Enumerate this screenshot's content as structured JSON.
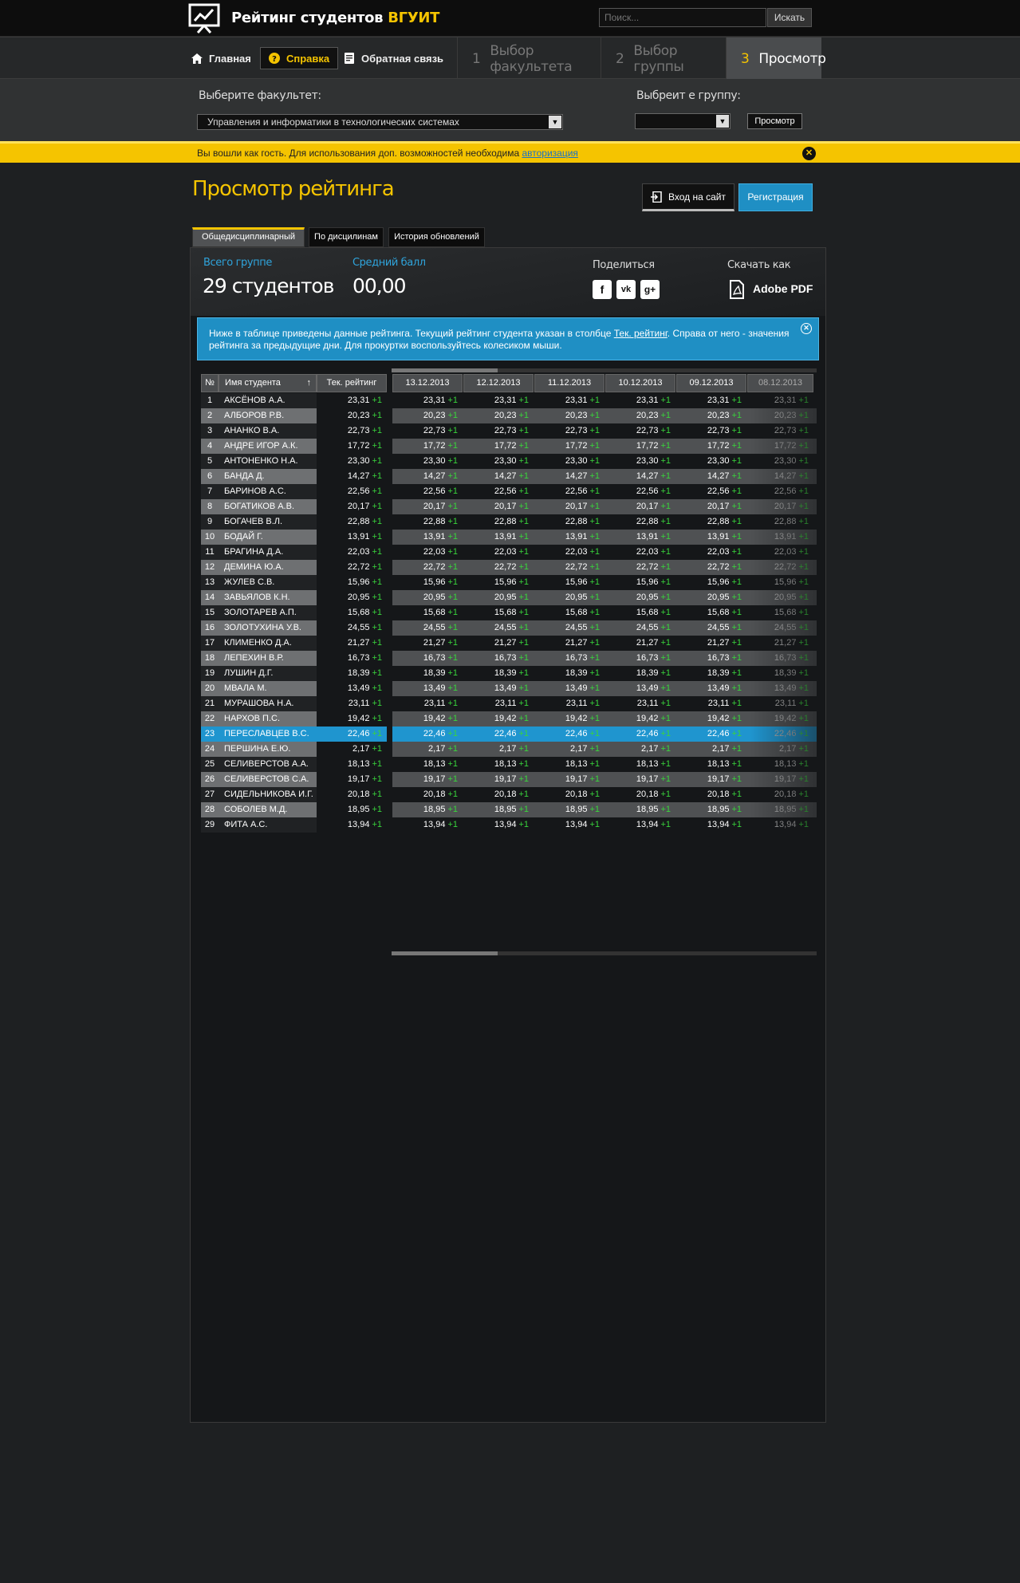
{
  "app": {
    "title_main": "Рейтинг студентов ",
    "title_accent": "ВГУИТ"
  },
  "search": {
    "placeholder": "Поиск...",
    "button": "Искать"
  },
  "nav": {
    "home": "Главная",
    "help": "Справка",
    "feedback": "Обратная связь",
    "steps": [
      {
        "num": "1",
        "label": "Выбор факультета"
      },
      {
        "num": "2",
        "label": "Выбор группы"
      },
      {
        "num": "3",
        "label": "Просмотр"
      }
    ]
  },
  "selector": {
    "faculty_label": "Выберите факультет:",
    "faculty_value": "Управления и информатики в технологических системах",
    "group_label": "Выбреит е группу:",
    "group_value": "",
    "view_button": "Просмотр"
  },
  "banner": {
    "text": "Вы вошли как гость. Для использования доп. возможностей необходима ",
    "link": "авторизация"
  },
  "page": {
    "title": "Просмотр рейтинга",
    "login_button": "Вход на сайт",
    "register_button": "Регистрация"
  },
  "tabs": [
    "Общедисциплинарный",
    "По дисцилинам",
    "История обновлений"
  ],
  "stats": {
    "total_label": "Всего группе",
    "total_value": "29 студентов",
    "avg_label": "Средний балл",
    "avg_value": "00,00",
    "share_label": "Поделиться",
    "download_label": "Скачать как",
    "download_format": "Adobe PDF"
  },
  "info": {
    "text_before": "Ниже в таблице приведены данные рейтинга. Текущий рейтинг студента указан в столбце ",
    "link": "Тек. рейтинг",
    "text_after": ". Справа от него - значения рейтинга за предыдущие дни. Для прокуртки воспользуйтесь колесиком мыши."
  },
  "table": {
    "headers": {
      "num": "№",
      "name": "Имя студента",
      "sort_icon": "↑",
      "current": "Тек. рейтинг"
    },
    "dates": [
      "13.12.2013",
      "12.12.2013",
      "11.12.2013",
      "10.12.2013",
      "09.12.2013",
      "08.12.2013"
    ],
    "delta": "+1",
    "selected_row": 23,
    "rows": [
      {
        "num": "1",
        "name": "АКСЁНОВ А.А.",
        "value": "23,31"
      },
      {
        "num": "2",
        "name": "АЛБОРОВ Р.В.",
        "value": "20,23"
      },
      {
        "num": "3",
        "name": "АНАНКО В.А.",
        "value": "22,73"
      },
      {
        "num": "4",
        "name": "АНДРЕ ИГОР А.К.",
        "value": "17,72"
      },
      {
        "num": "5",
        "name": "АНТОНЕНКО Н.А.",
        "value": "23,30"
      },
      {
        "num": "6",
        "name": "БАНДА Д.",
        "value": "14,27"
      },
      {
        "num": "7",
        "name": "БАРИНОВ А.С.",
        "value": "22,56"
      },
      {
        "num": "8",
        "name": "БОГАТИКОВ А.В.",
        "value": "20,17"
      },
      {
        "num": "9",
        "name": "БОГАЧЕВ В.Л.",
        "value": "22,88"
      },
      {
        "num": "10",
        "name": "БОДАЙ Г.",
        "value": "13,91"
      },
      {
        "num": "11",
        "name": "БРАГИНА Д.А.",
        "value": "22,03"
      },
      {
        "num": "12",
        "name": "ДЕМИНА Ю.А.",
        "value": "22,72"
      },
      {
        "num": "13",
        "name": "ЖУЛЕВ С.В.",
        "value": "15,96"
      },
      {
        "num": "14",
        "name": "ЗАВЬЯЛОВ К.Н.",
        "value": "20,95"
      },
      {
        "num": "15",
        "name": "ЗОЛОТАРЕВ А.П.",
        "value": "15,68"
      },
      {
        "num": "16",
        "name": "ЗОЛОТУХИНА У.В.",
        "value": "24,55"
      },
      {
        "num": "17",
        "name": "КЛИМЕНКО Д.А.",
        "value": "21,27"
      },
      {
        "num": "18",
        "name": "ЛЕПЕХИН В.Р.",
        "value": "16,73"
      },
      {
        "num": "19",
        "name": "ЛУШИН Д.Г.",
        "value": "18,39"
      },
      {
        "num": "20",
        "name": "МВАЛА М.",
        "value": "13,49"
      },
      {
        "num": "21",
        "name": "МУРАШОВА Н.А.",
        "value": "23,11"
      },
      {
        "num": "22",
        "name": "НАРХОВ П.С.",
        "value": "19,42"
      },
      {
        "num": "23",
        "name": "ПЕРЕСЛАВЦЕВ В.С.",
        "value": "22,46"
      },
      {
        "num": "24",
        "name": "ПЕРШИНА Е.Ю.",
        "value": "2,17"
      },
      {
        "num": "25",
        "name": "СЕЛИВЕРСТОВ А.А.",
        "value": "18,13"
      },
      {
        "num": "26",
        "name": "СЕЛИВЕРСТОВ С.А.",
        "value": "19,17"
      },
      {
        "num": "27",
        "name": "СИДЕЛЬНИКОВА И.Г.",
        "value": "20,18"
      },
      {
        "num": "28",
        "name": "СОБОЛЕВ М.Д.",
        "value": "18,95"
      },
      {
        "num": "29",
        "name": "ФИТА А.С.",
        "value": "13,94"
      }
    ]
  },
  "colors": {
    "accent": "#f5c400",
    "info_blue": "#1f8fc4",
    "selected_row": "#1f95cf",
    "delta_green": "#39d43c"
  },
  "icons": [
    "logo-chart-icon",
    "home-icon",
    "help-icon",
    "feedback-icon",
    "login-icon",
    "facebook-icon",
    "vk-icon",
    "google-plus-icon",
    "pdf-icon",
    "close-icon",
    "dropdown-arrow-icon",
    "sort-arrow-icon"
  ]
}
